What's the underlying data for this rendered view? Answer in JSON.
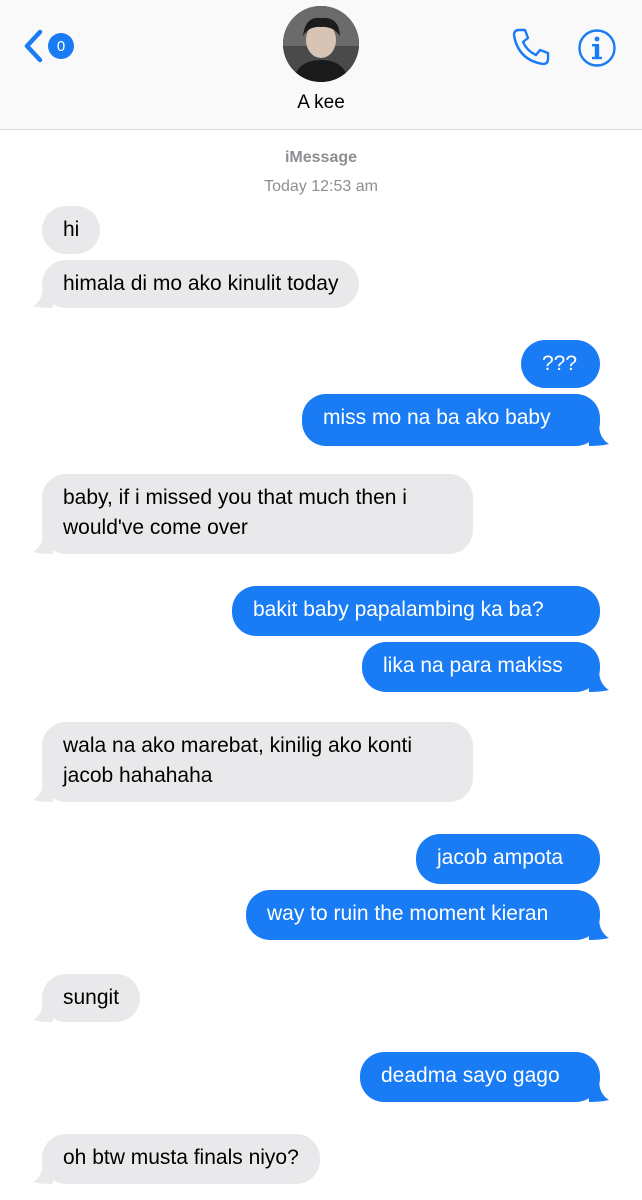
{
  "header": {
    "back_badge": "0",
    "contact_name": "A kee",
    "accent_color": "#1a7cf5"
  },
  "conversation": {
    "service": "iMessage",
    "timestamp": "Today 12:53 am"
  },
  "messages": [
    {
      "side": "in",
      "text": "hi"
    },
    {
      "side": "in",
      "text": "himala di mo ako kinulit today"
    },
    {
      "side": "out",
      "text": "???"
    },
    {
      "side": "out",
      "text": "miss mo na ba ako baby"
    },
    {
      "side": "in",
      "lines": [
        "baby, if i missed you that much then i",
        "would've come over"
      ]
    },
    {
      "side": "out",
      "text": "bakit baby papalambing ka ba?"
    },
    {
      "side": "out",
      "text": "lika na para makiss"
    },
    {
      "side": "in",
      "lines": [
        "wala na ako marebat, kinilig ako konti",
        "jacob hahahaha"
      ]
    },
    {
      "side": "out",
      "text": "jacob ampota"
    },
    {
      "side": "out",
      "text": "way to ruin the moment kieran"
    },
    {
      "side": "in",
      "text": "sungit"
    },
    {
      "side": "out",
      "text": "deadma sayo gago"
    },
    {
      "side": "in",
      "text": "oh btw musta finals niyo?"
    }
  ]
}
